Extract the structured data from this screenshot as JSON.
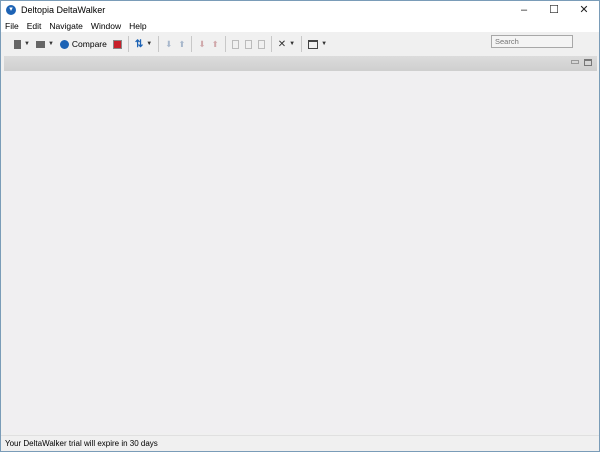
{
  "window": {
    "title": "Deltopia DeltaWalker",
    "minimize": "–",
    "maximize": "☐",
    "close": "✕"
  },
  "menu": [
    "File",
    "Edit",
    "Navigate",
    "Window",
    "Help"
  ],
  "toolbar": {
    "compare_label": "Compare",
    "search_placeholder": "Search"
  },
  "status": {
    "text": "Your DeltaWalker trial will expire in 30 days"
  },
  "colors": {
    "accent": "#1d63b5",
    "stop": "#c8202a"
  }
}
